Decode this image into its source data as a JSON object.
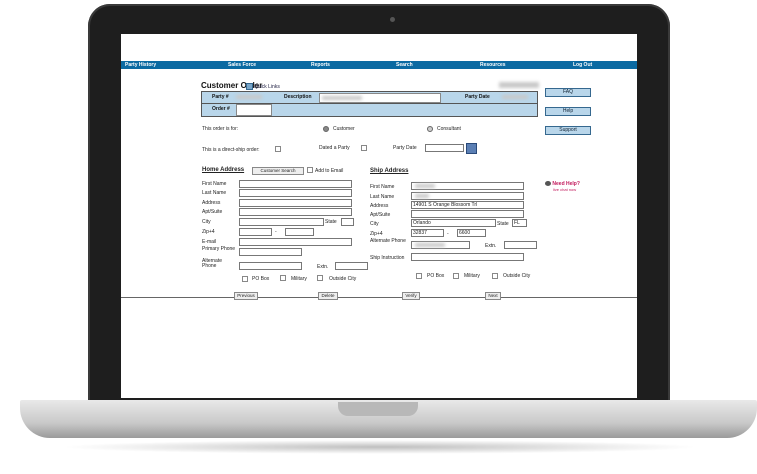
{
  "nav": [
    "Party History",
    "Sales Force",
    "Reports",
    "Search",
    "Resources",
    "Log Out"
  ],
  "header": {
    "title": "Customer Order",
    "quick_links": "Quick Links",
    "party_label": "Party #",
    "description_label": "Description",
    "party_date_label": "Party Date",
    "order_label": "Order #"
  },
  "side_buttons": {
    "faq": "FAQ",
    "help": "Help",
    "support": "Support"
  },
  "need_help": {
    "title": "Need Help?",
    "sub": "live chat now"
  },
  "order_for": {
    "label": "This order is for:",
    "customer": "Customer",
    "consultant": "Consultant"
  },
  "direct_ship": {
    "label": "This is a direct-ship order:",
    "dated_party": "Dated a Party",
    "party_date": "Party Date"
  },
  "home": {
    "heading": "Home Address",
    "customer_search": "Customer Search",
    "add_to_email": "Add to Email",
    "labels": [
      "First Name",
      "Last Name",
      "Address",
      "Apt/Suite",
      "City",
      "Zip+4",
      "E-mail",
      "Primary Phone",
      "Alternate Phone"
    ],
    "state": "State",
    "extn": "Extn.",
    "po_box": "PO Box",
    "military": "Military",
    "outside_city": "Outside City"
  },
  "ship": {
    "heading": "Ship Address",
    "labels": [
      "First Name",
      "Last Name",
      "Address",
      "Apt/Suite",
      "City",
      "Zip+4",
      "Alternate Phone",
      "Ship Instruction"
    ],
    "address": "14901 S Orange Blossom Trl",
    "city": "Orlando",
    "state_label": "State",
    "state": "FL",
    "zip": "32837",
    "zip4": "6600",
    "extn": "Extn.",
    "po_box": "PO Box",
    "military": "Military",
    "outside_city": "Outside City"
  },
  "bottom_buttons": {
    "previous": "Previous",
    "delete": "Delete",
    "verify": "Verify",
    "next": "Next"
  },
  "colors": {
    "nav": "#0b6aa2",
    "table": "#b9d6ea",
    "help": "#c2185b"
  }
}
